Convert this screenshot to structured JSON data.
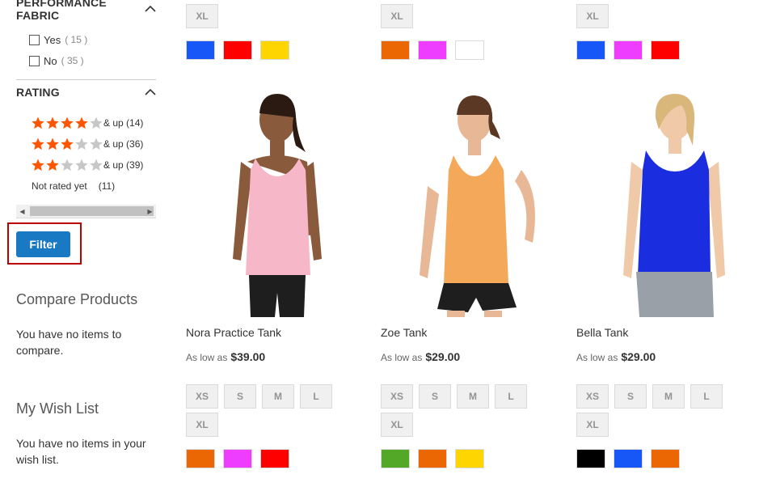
{
  "sidebar": {
    "performance_fabric": {
      "title": "PERFORMANCE FABRIC",
      "options": [
        {
          "label": "Yes",
          "count": "( 15 )"
        },
        {
          "label": "No",
          "count": "( 35 )"
        }
      ]
    },
    "rating": {
      "title": "RATING",
      "rows": [
        {
          "stars": 4,
          "label": "& up (14)"
        },
        {
          "stars": 3,
          "label": "& up (36)"
        },
        {
          "stars": 2,
          "label": "& up (39)"
        }
      ],
      "not_rated_label": "Not rated yet",
      "not_rated_count": "(11)"
    },
    "filter_button": "Filter",
    "compare": {
      "title": "Compare Products",
      "text": "You have no items to compare."
    },
    "wishlist": {
      "title": "My Wish List",
      "text": "You have no items in your wish list."
    }
  },
  "colors": {
    "accent": "#1979c3",
    "star_on": "#ff5501",
    "star_off": "#c7c7c7",
    "highlight_border": "#b00000"
  },
  "top_row": [
    {
      "size": "XL",
      "colors": [
        "#1857f7",
        "#ff0000",
        "#ffd500"
      ]
    },
    {
      "size": "XL",
      "colors": [
        "#eb6703",
        "#ef3dff",
        "#ffffff"
      ]
    },
    {
      "size": "XL",
      "colors": [
        "#1857f7",
        "#ef3dff",
        "#ff0000"
      ]
    }
  ],
  "products": [
    {
      "name": "Nora Practice Tank",
      "price_prefix": "As low as",
      "price": "$39.00",
      "sizes": [
        "XS",
        "S",
        "M",
        "L",
        "XL"
      ],
      "colors": [
        "#eb6703",
        "#ef3dff",
        "#ff0000"
      ],
      "image": "woman-pink-tank-photo"
    },
    {
      "name": "Zoe Tank",
      "price_prefix": "As low as",
      "price": "$29.00",
      "sizes": [
        "XS",
        "S",
        "M",
        "L",
        "XL"
      ],
      "colors": [
        "#53a828",
        "#eb6703",
        "#ffd500"
      ],
      "image": "woman-orange-tank-photo"
    },
    {
      "name": "Bella Tank",
      "price_prefix": "As low as",
      "price": "$29.00",
      "sizes": [
        "XS",
        "S",
        "M",
        "L",
        "XL"
      ],
      "colors": [
        "#000000",
        "#1857f7",
        "#eb6703"
      ],
      "image": "woman-blue-tank-photo"
    }
  ]
}
